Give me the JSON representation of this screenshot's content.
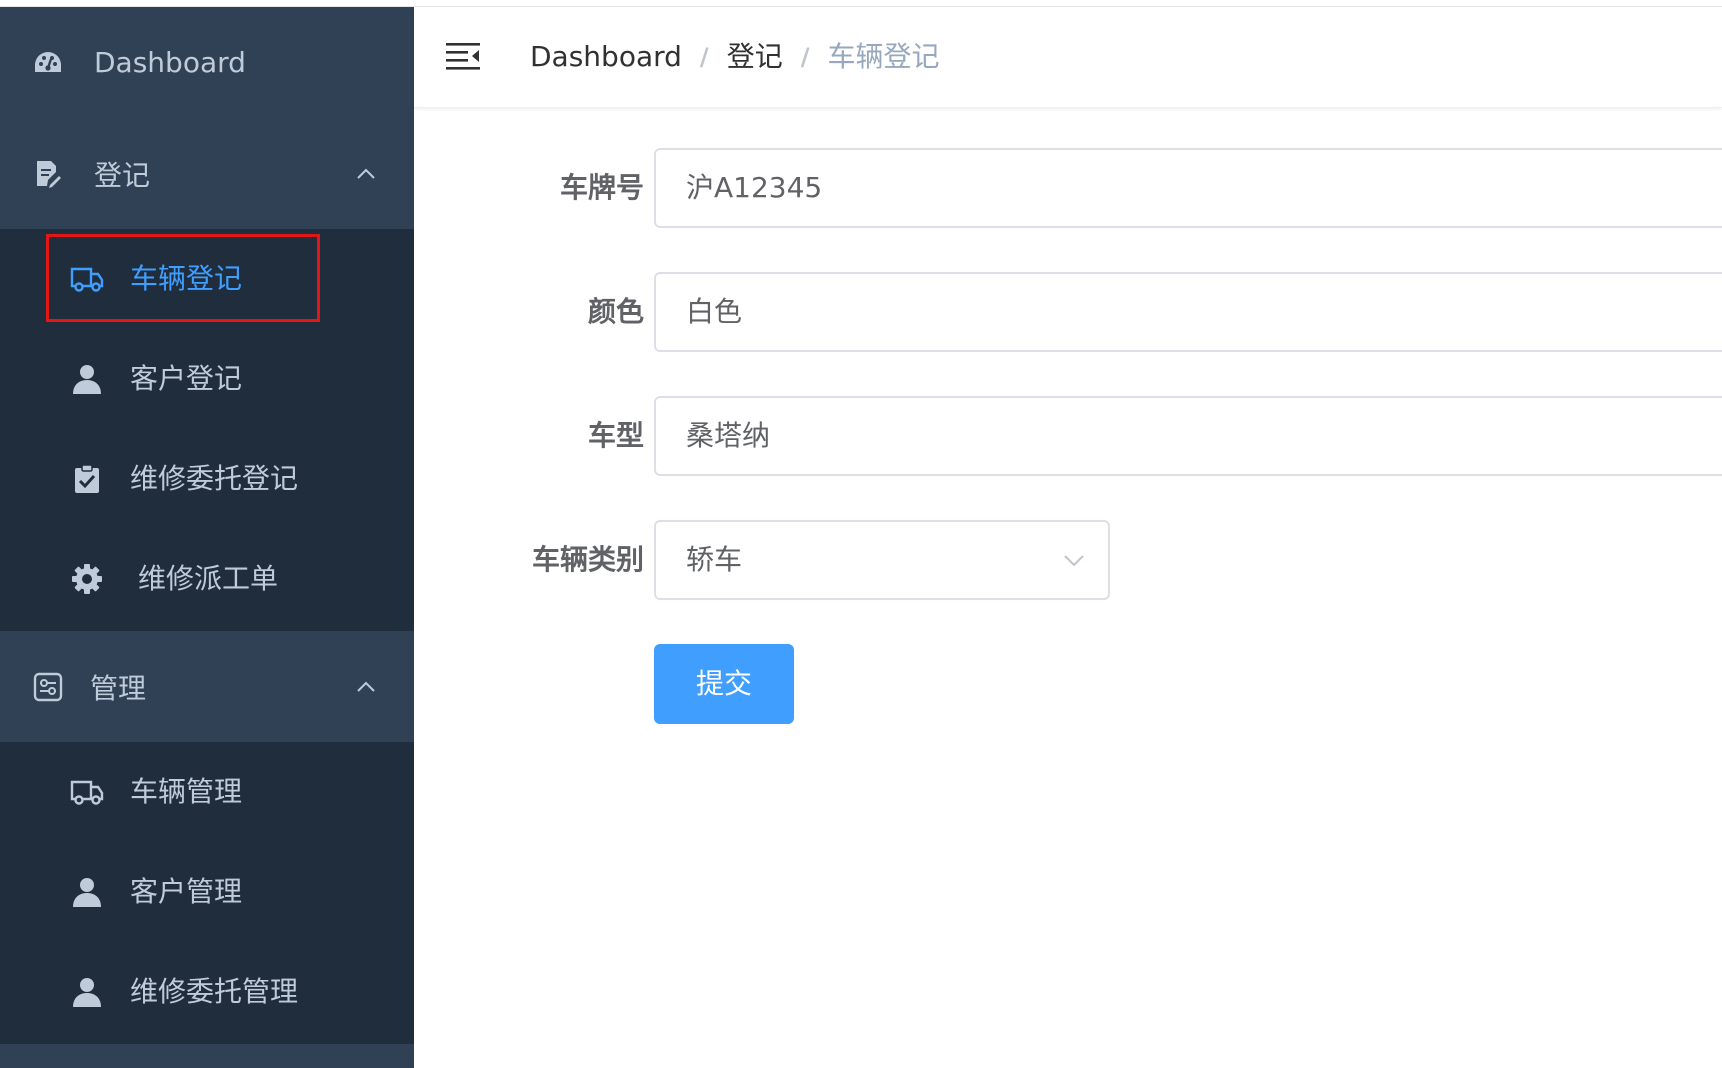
{
  "colors": {
    "sidebar_bg": "#1f2d3d",
    "sidebar_header_bg": "#304156",
    "sidebar_text": "#bfcbd9",
    "active_text": "#409eff",
    "primary": "#409eff",
    "highlight_box": "#e31515"
  },
  "sidebar": {
    "dashboard": {
      "label": "Dashboard",
      "icon": "dashboard-icon"
    },
    "register_group": {
      "label": "登记",
      "icon": "document-edit-icon",
      "expanded": true,
      "items": [
        {
          "label": "车辆登记",
          "icon": "truck-icon",
          "active": true
        },
        {
          "label": "客户登记",
          "icon": "user-icon",
          "active": false
        },
        {
          "label": "维修委托登记",
          "icon": "clipboard-check-icon",
          "active": false
        },
        {
          "label": "维修派工单",
          "icon": "gear-icon",
          "active": false
        }
      ]
    },
    "manage_group": {
      "label": "管理",
      "icon": "control-panel-icon",
      "expanded": true,
      "items": [
        {
          "label": "车辆管理",
          "icon": "truck-icon",
          "active": false
        },
        {
          "label": "客户管理",
          "icon": "user-icon",
          "active": false
        },
        {
          "label": "维修委托管理",
          "icon": "user-icon",
          "active": false
        }
      ]
    }
  },
  "header": {
    "hamburger_icon": "menu-fold-icon",
    "breadcrumb": [
      "Dashboard",
      "登记",
      "车辆登记"
    ],
    "separator": "/"
  },
  "form": {
    "plate": {
      "label": "车牌号",
      "value": "沪A12345"
    },
    "color": {
      "label": "颜色",
      "value": "白色"
    },
    "model": {
      "label": "车型",
      "value": "桑塔纳"
    },
    "category": {
      "label": "车辆类别",
      "value": "轿车"
    },
    "submit_label": "提交"
  }
}
